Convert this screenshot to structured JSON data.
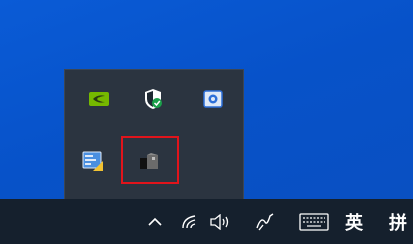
{
  "tray_popup": {
    "icons": [
      {
        "name": "nvidia-icon",
        "color": "#76b900"
      },
      {
        "name": "security-shield-icon",
        "color": "#ffffff"
      },
      {
        "name": "camera-app-icon",
        "color": "#2d6fd8"
      },
      {
        "name": "display-settings-icon",
        "color": "#3a7bd5"
      },
      {
        "name": "unknown-app-icon",
        "color": "#555555"
      }
    ],
    "highlight_color": "#e1141b"
  },
  "taskbar": {
    "chevron": "^",
    "ime_language": "英",
    "ime_mode": "拼"
  }
}
